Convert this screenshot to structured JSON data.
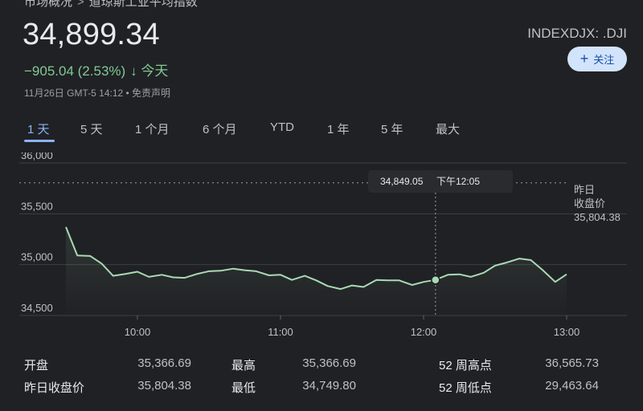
{
  "breadcrumb": [
    "市场概况",
    "道琼斯工业平均指数"
  ],
  "quote": {
    "price": "34,899.34",
    "change": "−905.04 (2.53%)",
    "change_arrow": "↓",
    "period": "今天",
    "timestamp": "11月26日 GMT-5 14:12 • 免责声明",
    "ticker": "INDEXDJX: .DJI"
  },
  "follow_button": {
    "label": "关注",
    "icon": "plus-icon"
  },
  "tabs": [
    "1 天",
    "5 天",
    "1 个月",
    "6 个月",
    "YTD",
    "1 年",
    "5 年",
    "最大"
  ],
  "active_tab": 0,
  "colors": {
    "background": "#202124",
    "line": "#a8dab5",
    "accent": "#8ab4f8",
    "negative_change": "#81c995"
  },
  "tooltip": {
    "value": "34,849.05",
    "time": "下午12:05"
  },
  "prev_close": {
    "line1": "昨日",
    "line2": "收盘价",
    "value": "35,804.38"
  },
  "chart_data": {
    "type": "line",
    "x_ticks": [
      "10:00",
      "11:00",
      "12:00",
      "13:00"
    ],
    "y_ticks": [
      "36,000",
      "35,500",
      "35,000",
      "34,500"
    ],
    "ylim": [
      34500,
      36000
    ],
    "previous_close": 35804.38,
    "hover_point": {
      "time": "12:05",
      "value": 34849.05
    },
    "x_unit": "hours since 9:30",
    "points": [
      [
        0.0,
        35370
      ],
      [
        0.08,
        35090
      ],
      [
        0.17,
        35085
      ],
      [
        0.25,
        35010
      ],
      [
        0.33,
        34890
      ],
      [
        0.42,
        34910
      ],
      [
        0.5,
        34930
      ],
      [
        0.58,
        34880
      ],
      [
        0.67,
        34900
      ],
      [
        0.75,
        34875
      ],
      [
        0.83,
        34870
      ],
      [
        0.92,
        34910
      ],
      [
        1.0,
        34935
      ],
      [
        1.08,
        34940
      ],
      [
        1.17,
        34960
      ],
      [
        1.25,
        34945
      ],
      [
        1.33,
        34935
      ],
      [
        1.42,
        34895
      ],
      [
        1.5,
        34900
      ],
      [
        1.58,
        34850
      ],
      [
        1.67,
        34890
      ],
      [
        1.75,
        34845
      ],
      [
        1.83,
        34790
      ],
      [
        1.92,
        34760
      ],
      [
        2.0,
        34795
      ],
      [
        2.08,
        34780
      ],
      [
        2.17,
        34850
      ],
      [
        2.25,
        34845
      ],
      [
        2.33,
        34845
      ],
      [
        2.42,
        34800
      ],
      [
        2.5,
        34830
      ],
      [
        2.58,
        34849
      ],
      [
        2.67,
        34900
      ],
      [
        2.75,
        34905
      ],
      [
        2.83,
        34880
      ],
      [
        2.92,
        34920
      ],
      [
        3.0,
        34990
      ],
      [
        3.08,
        35020
      ],
      [
        3.17,
        35060
      ],
      [
        3.25,
        35045
      ],
      [
        3.33,
        34950
      ],
      [
        3.42,
        34830
      ],
      [
        3.5,
        34905
      ]
    ]
  },
  "stats": [
    {
      "label": "开盘",
      "value": "35,366.69"
    },
    {
      "label": "最高",
      "value": "35,366.69"
    },
    {
      "label": "52 周高点",
      "value": "36,565.73"
    },
    {
      "label": "昨日收盘价",
      "value": "35,804.38"
    },
    {
      "label": "最低",
      "value": "34,749.80"
    },
    {
      "label": "52 周低点",
      "value": "29,463.64"
    }
  ]
}
